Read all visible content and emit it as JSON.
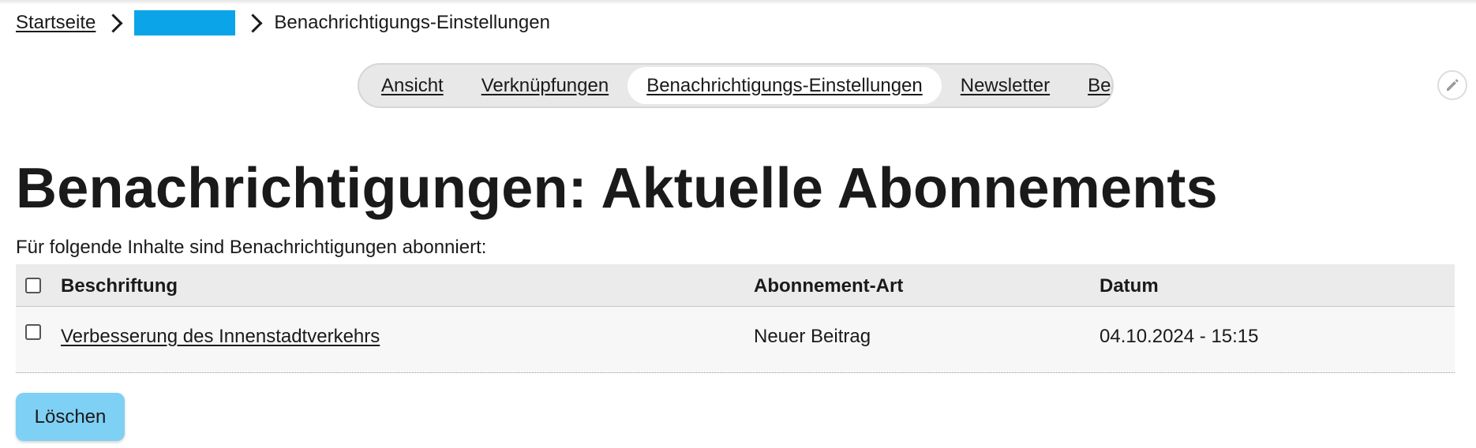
{
  "breadcrumb": {
    "home": "Startseite",
    "current": "Benachrichtigungs-Einstellungen"
  },
  "tabs": [
    {
      "label": "Ansicht",
      "active": false
    },
    {
      "label": "Verknüpfungen",
      "active": false
    },
    {
      "label": "Benachrichtigungs-Einstellungen",
      "active": true
    },
    {
      "label": "Newsletter",
      "active": false
    },
    {
      "label": "Bearbeiten",
      "active": false
    }
  ],
  "icons": {
    "breadcrumb_separator": "chevron-right-icon",
    "edit": "pencil-icon"
  },
  "page": {
    "title": "Benachrichtigungen: Aktuelle Abonnements",
    "intro": "Für folgende Inhalte sind Benachrichtigungen abonniert:"
  },
  "table": {
    "headers": {
      "label": "Beschriftung",
      "type": "Abonnement-Art",
      "date": "Datum"
    },
    "rows": [
      {
        "label": "Verbesserung des Innenstadtverkehrs",
        "type": "Neuer Beitrag",
        "date": "04.10.2024 - 15:15",
        "checked": false
      }
    ]
  },
  "actions": {
    "delete_label": "Löschen"
  },
  "colors": {
    "accent": "#0ba4e8",
    "button": "#7fd0f5",
    "tab_bar": "#e8e8e8",
    "table_header": "#ebebeb"
  }
}
